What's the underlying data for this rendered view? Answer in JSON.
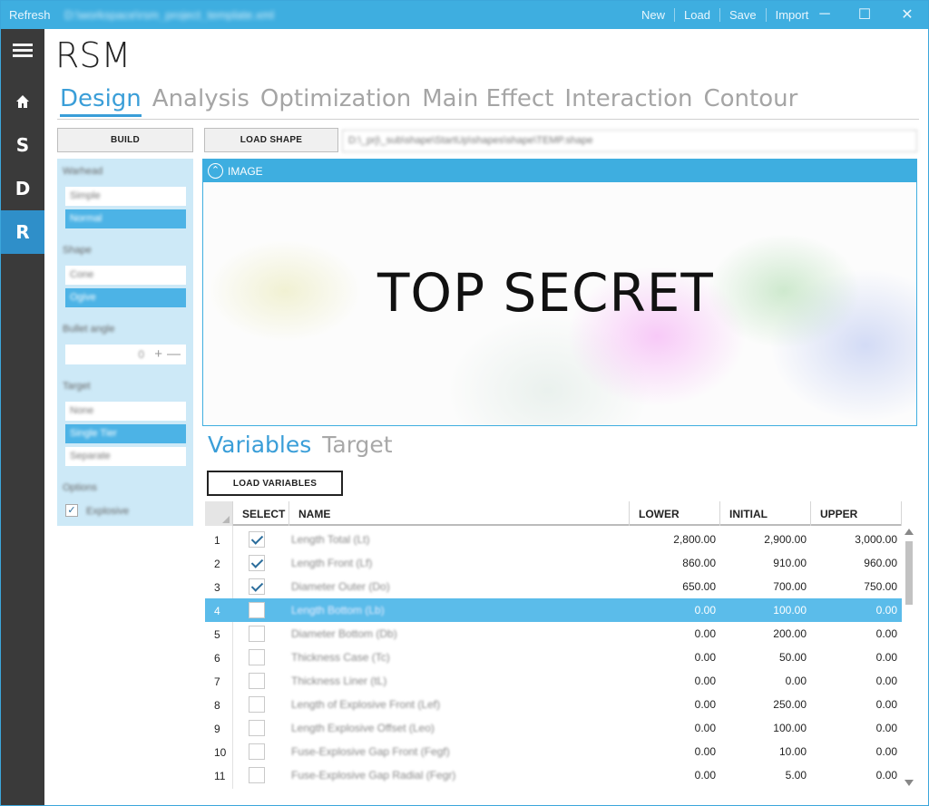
{
  "titlebar": {
    "refresh": "Refresh",
    "path": "D:\\workspace\\rsm_project_template.xml",
    "menu": [
      "New",
      "Load",
      "Save",
      "Import"
    ],
    "minimize": "─",
    "maximize": "☐",
    "close": "✕"
  },
  "nav": {
    "items": [
      "S",
      "D",
      "R"
    ],
    "home_glyph": "⌂"
  },
  "app": {
    "title": "RSM"
  },
  "tabs": [
    "Design",
    "Analysis",
    "Optimization",
    "Main Effect",
    "Interaction",
    "Contour"
  ],
  "toolbar": {
    "build": "BUILD",
    "load_shape": "LOAD SHAPE",
    "shape_path": "D:\\_prj\\_sub\\shape\\StartUp\\shapes\\shape\\TEMP.shape"
  },
  "options": {
    "group1_label": "Warhead",
    "group1": [
      "Simple",
      "Normal"
    ],
    "group2_label": "Shape",
    "group2": [
      "Cone",
      "Ogive"
    ],
    "group3_label": "Bullet angle",
    "stepper_value": "0",
    "stepper_plus": "+",
    "stepper_minus": "—",
    "group4_label": "Target",
    "group4": [
      "None",
      "Single Tier",
      "Separate"
    ],
    "group5_label": "Options",
    "check_label": "Explosive"
  },
  "image": {
    "header": "IMAGE",
    "collapse_glyph": "⌃",
    "overlay": "TOP SECRET"
  },
  "subtabs": [
    "Variables",
    "Target"
  ],
  "load_variables": "LOAD VARIABLES",
  "table": {
    "columns": [
      "SELECT",
      "NAME",
      "LOWER",
      "INITIAL",
      "UPPER"
    ],
    "rows": [
      {
        "idx": "1",
        "checked": true,
        "name": "Length Total (Lt)",
        "lower": "2,800.00",
        "initial": "2,900.00",
        "upper": "3,000.00"
      },
      {
        "idx": "2",
        "checked": true,
        "name": "Length Front (Lf)",
        "lower": "860.00",
        "initial": "910.00",
        "upper": "960.00"
      },
      {
        "idx": "3",
        "checked": true,
        "name": "Diameter Outer (Do)",
        "lower": "650.00",
        "initial": "700.00",
        "upper": "750.00"
      },
      {
        "idx": "4",
        "checked": false,
        "name": "Length Bottom (Lb)",
        "lower": "0.00",
        "initial": "100.00",
        "upper": "0.00"
      },
      {
        "idx": "5",
        "checked": false,
        "name": "Diameter Bottom (Db)",
        "lower": "0.00",
        "initial": "200.00",
        "upper": "0.00"
      },
      {
        "idx": "6",
        "checked": false,
        "name": "Thickness Case (Tc)",
        "lower": "0.00",
        "initial": "50.00",
        "upper": "0.00"
      },
      {
        "idx": "7",
        "checked": false,
        "name": "Thickness Liner (tL)",
        "lower": "0.00",
        "initial": "0.00",
        "upper": "0.00"
      },
      {
        "idx": "8",
        "checked": false,
        "name": "Length of Explosive Front (Lef)",
        "lower": "0.00",
        "initial": "250.00",
        "upper": "0.00"
      },
      {
        "idx": "9",
        "checked": false,
        "name": "Length Explosive Offset (Leo)",
        "lower": "0.00",
        "initial": "100.00",
        "upper": "0.00"
      },
      {
        "idx": "10",
        "checked": false,
        "name": "Fuse-Explosive Gap Front (Fegf)",
        "lower": "0.00",
        "initial": "10.00",
        "upper": "0.00"
      },
      {
        "idx": "11",
        "checked": false,
        "name": "Fuse-Explosive Gap Radial (Fegr)",
        "lower": "0.00",
        "initial": "5.00",
        "upper": "0.00"
      }
    ],
    "selected_row": 4
  },
  "colors": {
    "accent": "#3eaee0",
    "nav_bg": "#3a3a3a",
    "selection": "#5bbcea"
  }
}
